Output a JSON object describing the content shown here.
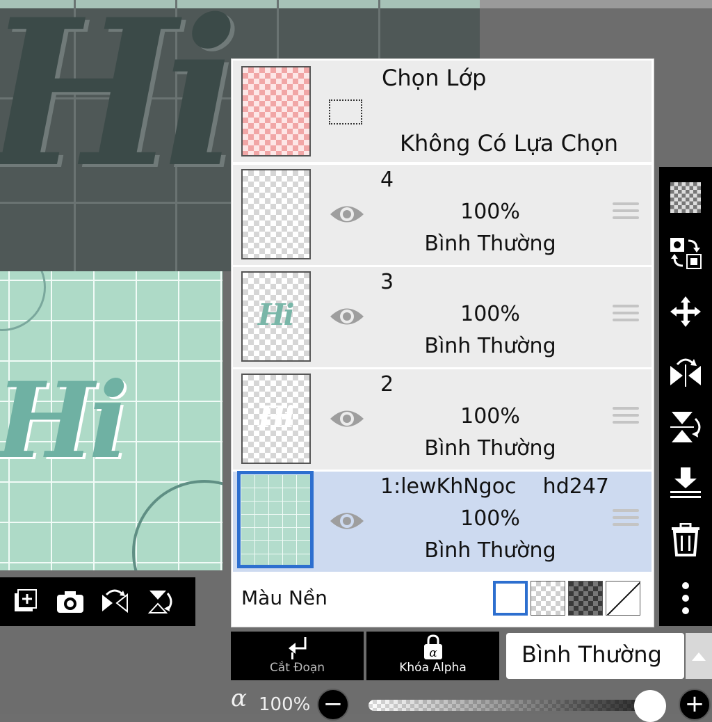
{
  "canvas": {
    "big_text": "Hi",
    "preview_text": "Hi"
  },
  "preview_toolbar": {
    "items": [
      {
        "name": "add-layer-icon"
      },
      {
        "name": "camera-icon"
      },
      {
        "name": "flip-horizontal-icon"
      },
      {
        "name": "flip-vertical-icon"
      }
    ]
  },
  "layers_panel": {
    "selection": {
      "title": "Chọn Lớp",
      "status": "Không Có Lựa Chọn"
    },
    "layers": [
      {
        "name": "4",
        "opacity": "100%",
        "blend": "Bình Thường",
        "thumb_text": "",
        "selected": false
      },
      {
        "name": "3",
        "opacity": "100%",
        "blend": "Bình Thường",
        "thumb_text": "Hi",
        "selected": false
      },
      {
        "name": "2",
        "opacity": "100%",
        "blend": "Bình Thường",
        "thumb_text": "Hi",
        "selected": false
      },
      {
        "name": "1:lewKhNgoc    hd247",
        "opacity": "100%",
        "blend": "Bình Thường",
        "thumb_text": "",
        "selected": true
      }
    ],
    "background": {
      "label": "Màu Nền",
      "options": [
        "white",
        "light-checker",
        "dark-checker",
        "none"
      ],
      "selected": "white"
    }
  },
  "right_toolbar": {
    "items": [
      "transparency-icon",
      "swap-icon",
      "move-icon",
      "flip-horizontal-icon",
      "flip-vertical-icon",
      "merge-down-icon",
      "trash-icon",
      "more-icon"
    ]
  },
  "bottom": {
    "clip_label": "Cắt Đoạn",
    "alpha_lock_label": "Khóa Alpha",
    "blend_mode": "Bình Thường",
    "opacity_symbol": "α",
    "opacity_value": "100%",
    "minus": "−",
    "plus": "+"
  },
  "colors": {
    "accent": "#2d6fcf",
    "selected_row": "#cddaf0",
    "toolbar": "#000000",
    "canvas_mint": "#aedac7"
  }
}
